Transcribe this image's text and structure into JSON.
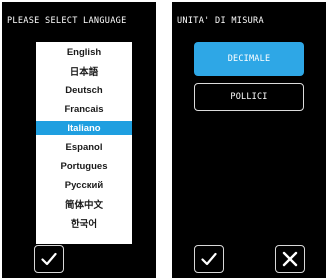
{
  "language_screen": {
    "header": "PLEASE SELECT LANGUAGE",
    "languages": [
      {
        "label": "English"
      },
      {
        "label": "日本語"
      },
      {
        "label": "Deutsch"
      },
      {
        "label": "Francais"
      },
      {
        "label": "Italiano"
      },
      {
        "label": "Espanol"
      },
      {
        "label": "Portugues"
      },
      {
        "label": "Русский"
      },
      {
        "label": "简体中文"
      },
      {
        "label": "한국어"
      }
    ],
    "selected_index": 4,
    "confirm_icon": "check-icon"
  },
  "unit_screen": {
    "header": "UNITA' DI MISURA",
    "options": [
      {
        "label": "DECIMALE",
        "selected": true
      },
      {
        "label": "POLLICI",
        "selected": false
      }
    ],
    "confirm_icon": "check-icon",
    "cancel_icon": "close-icon"
  },
  "colors": {
    "panel_background": "#000000",
    "selection_accent": "#1f9fe0",
    "button_accent": "#2ea7e6",
    "border": "#d8d8d8"
  }
}
